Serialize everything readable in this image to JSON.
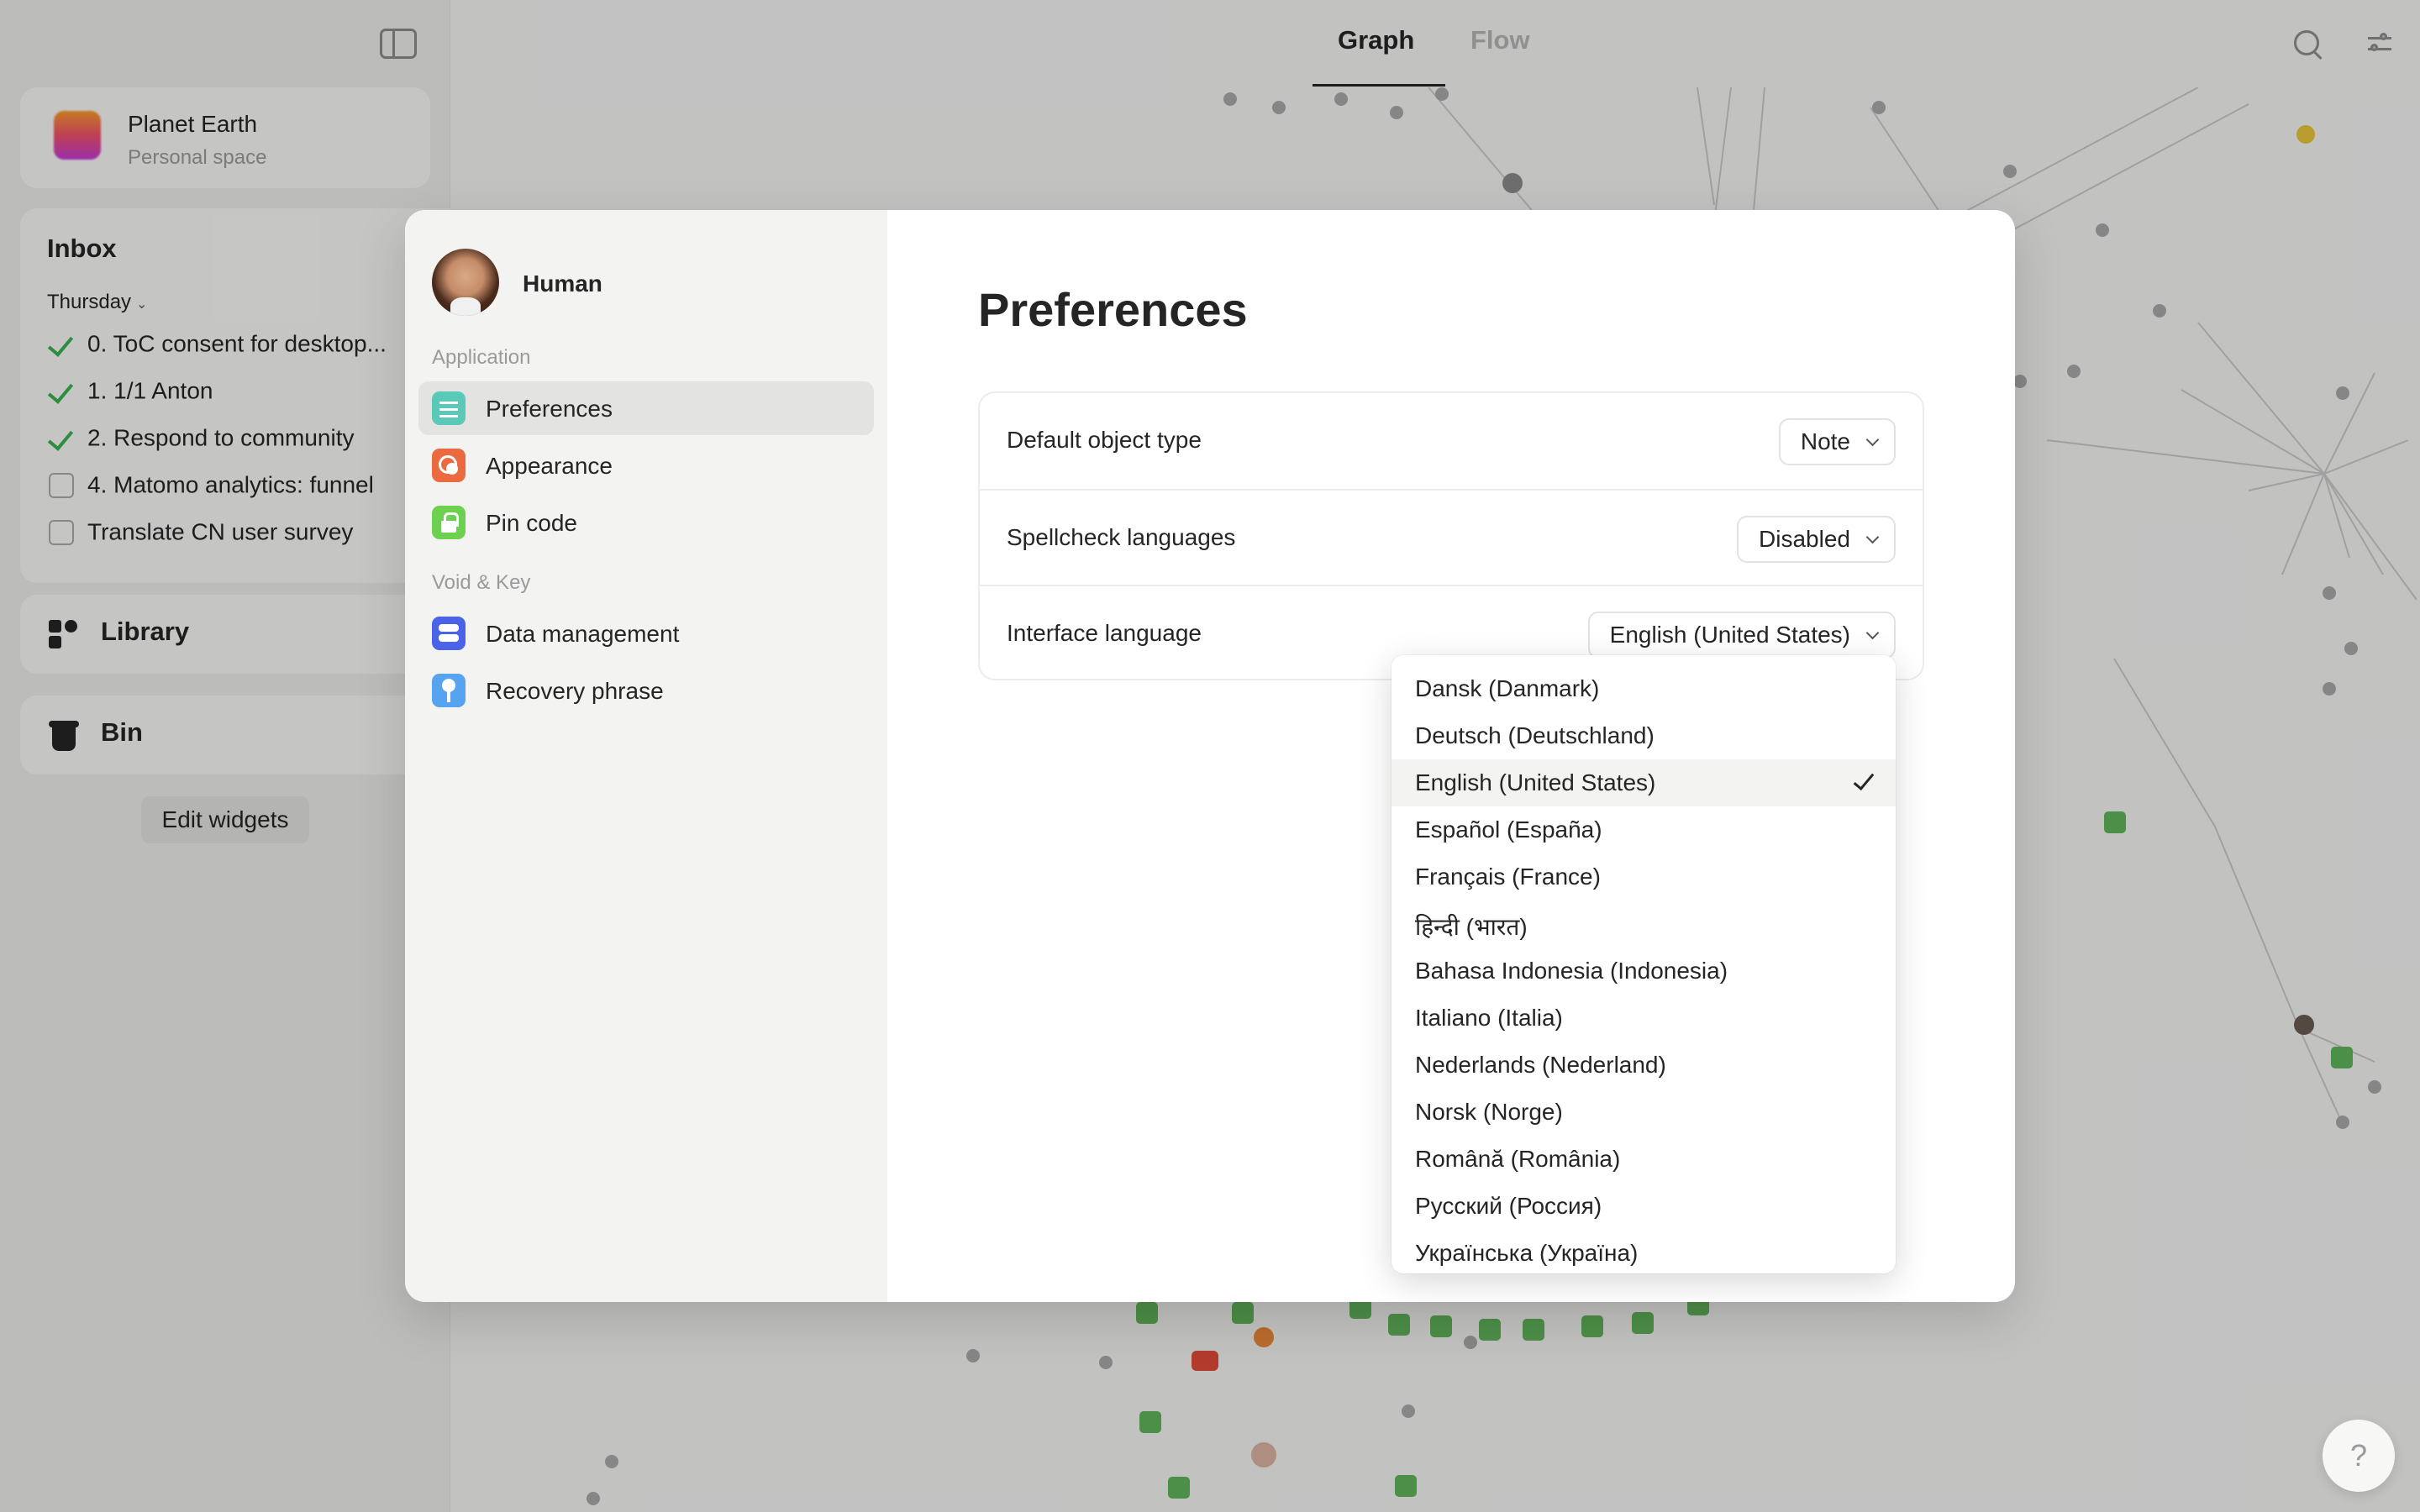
{
  "sidebar": {
    "space": {
      "name": "Planet Earth",
      "subtitle": "Personal space"
    },
    "inbox": {
      "title": "Inbox",
      "day": "Thursday",
      "tasks": [
        {
          "label": "0. ToC consent for desktop...",
          "done": true
        },
        {
          "label": "1. 1/1 Anton",
          "done": true
        },
        {
          "label": "2. Respond to community",
          "done": true
        },
        {
          "label": "4. Matomo analytics: funnel",
          "done": false
        },
        {
          "label": "Translate CN user survey",
          "done": false
        }
      ]
    },
    "library_label": "Library",
    "bin_label": "Bin",
    "edit_widgets_label": "Edit widgets"
  },
  "topbar": {
    "tabs": [
      {
        "label": "Graph",
        "active": true
      },
      {
        "label": "Flow",
        "active": false
      }
    ]
  },
  "modal": {
    "user_name": "Human",
    "sections": [
      {
        "title": "Application",
        "items": [
          {
            "label": "Preferences",
            "icon": "sliders-icon",
            "color": "#5ac9b7",
            "active": true
          },
          {
            "label": "Appearance",
            "icon": "palette-icon",
            "color": "#ec6a3f",
            "active": false
          },
          {
            "label": "Pin code",
            "icon": "lock-icon",
            "color": "#6ed050",
            "active": false
          }
        ]
      },
      {
        "title": "Void & Key",
        "items": [
          {
            "label": "Data management",
            "icon": "database-icon",
            "color": "#4b63e6",
            "active": false
          },
          {
            "label": "Recovery phrase",
            "icon": "key-icon",
            "color": "#56a4ef",
            "active": false
          }
        ]
      }
    ],
    "page_title": "Preferences",
    "settings": [
      {
        "label": "Default object type",
        "value": "Note"
      },
      {
        "label": "Spellcheck languages",
        "value": "Disabled"
      },
      {
        "label": "Interface language",
        "value": "English (United States)"
      }
    ]
  },
  "language_dropdown": {
    "selected": "English (United States)",
    "options": [
      "Dansk (Danmark)",
      "Deutsch (Deutschland)",
      "English (United States)",
      "Español (España)",
      "Français (France)",
      "हिन्दी (भारत)",
      "Bahasa Indonesia (Indonesia)",
      "Italiano (Italia)",
      "Nederlands (Nederland)",
      "Norsk (Norge)",
      "Română (România)",
      "Русский (Россия)",
      "Українська (Україна)"
    ]
  },
  "help_label": "?"
}
